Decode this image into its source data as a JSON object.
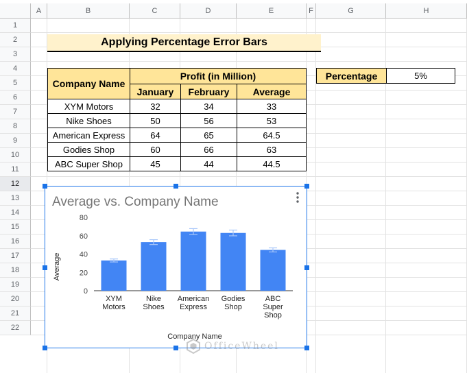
{
  "spreadsheet": {
    "columns": [
      "A",
      "B",
      "C",
      "D",
      "E",
      "F",
      "G",
      "H"
    ],
    "rows": [
      "1",
      "2",
      "3",
      "4",
      "5",
      "6",
      "7",
      "8",
      "9",
      "10",
      "11",
      "12",
      "13",
      "14",
      "15",
      "16",
      "17",
      "18",
      "19",
      "20",
      "21",
      "22"
    ],
    "selected_row": "12"
  },
  "title_band": {
    "text": "Applying Percentage Error Bars"
  },
  "table": {
    "company_header": "Company Name",
    "profit_header": "Profit (in Million)",
    "sub_headers": [
      "January",
      "February",
      "Average"
    ],
    "rows": [
      {
        "company": "XYM Motors",
        "january": "32",
        "february": "34",
        "average": "33"
      },
      {
        "company": "Nike Shoes",
        "january": "50",
        "february": "56",
        "average": "53"
      },
      {
        "company": "American Express",
        "january": "64",
        "february": "65",
        "average": "64.5"
      },
      {
        "company": "Godies Shop",
        "january": "60",
        "february": "66",
        "average": "63"
      },
      {
        "company": "ABC Super Shop",
        "january": "45",
        "february": "44",
        "average": "44.5"
      }
    ]
  },
  "percentage": {
    "label": "Percentage",
    "value": "5%"
  },
  "chart": {
    "menu_icon": "more-vert-icon",
    "selection_color": "#1a73e8",
    "bar_color": "#4285f4",
    "error_bar_color": "#a8c7fa"
  },
  "watermark": {
    "text": "OfficeWheel",
    "icon": "officewheel-logo"
  },
  "chart_data": {
    "type": "bar",
    "title": "Average vs. Company Name",
    "xlabel": "Company Name",
    "ylabel": "Average",
    "categories": [
      [
        "XYM",
        "Motors"
      ],
      [
        "Nike",
        "Shoes"
      ],
      [
        "American",
        "Express"
      ],
      [
        "Godies",
        "Shop"
      ],
      [
        "ABC",
        "Super",
        "Shop"
      ]
    ],
    "values": [
      33,
      53,
      64.5,
      63,
      44.5
    ],
    "error_percent": 5,
    "ylim": [
      0,
      80
    ],
    "yticks": [
      "0",
      "20",
      "40",
      "60",
      "80"
    ],
    "grid": false,
    "legend": "none"
  }
}
